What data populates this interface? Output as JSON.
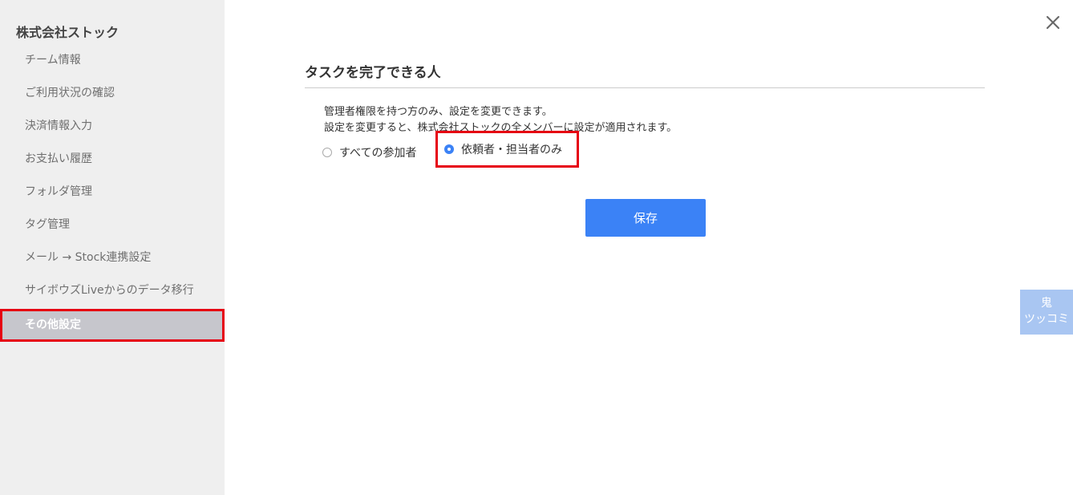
{
  "sidebar": {
    "title": "株式会社ストック",
    "items": [
      {
        "label": "チーム情報"
      },
      {
        "label": "ご利用状況の確認"
      },
      {
        "label": "決済情報入力"
      },
      {
        "label": "お支払い履歴"
      },
      {
        "label": "フォルダ管理"
      },
      {
        "label": "タグ管理"
      },
      {
        "label": "メール → Stock連携設定"
      },
      {
        "label": "サイボウズLiveからのデータ移行"
      },
      {
        "label": "その他設定",
        "active": true
      }
    ]
  },
  "main": {
    "section_title": "タスクを完了できる人",
    "description_line1": "管理者権限を持つ方のみ、設定を変更できます。",
    "description_line2": "設定を変更すると、株式会社ストックの全メンバーに設定が適用されます。",
    "options": [
      {
        "label": "すべての参加者",
        "selected": false
      },
      {
        "label": "依頼者・担当者のみ",
        "selected": true
      }
    ],
    "save_label": "保存"
  },
  "side_tab": {
    "line1": "鬼",
    "line2": "ツッコミ"
  },
  "icons": {
    "close": "close-icon"
  },
  "colors": {
    "accent": "#3b82f6",
    "highlight": "#e60012",
    "sidebar_bg": "#efefef",
    "active_item_bg": "#c6c6cc",
    "side_tab_bg": "#a9c6f2"
  }
}
